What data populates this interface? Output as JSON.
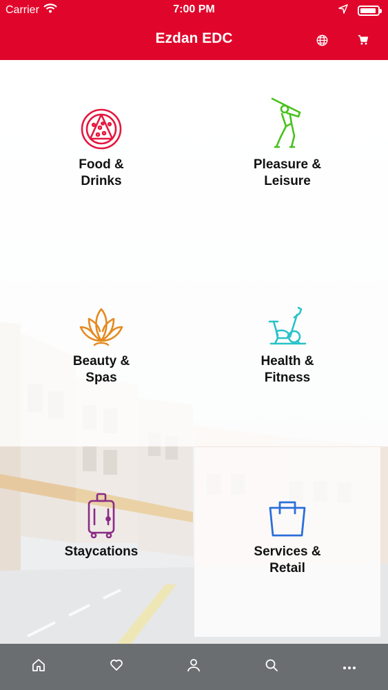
{
  "status_bar": {
    "carrier": "Carrier",
    "time": "7:00 PM"
  },
  "header": {
    "title": "Ezdan EDC",
    "globe_icon": "globe-icon",
    "cart_icon": "cart-icon"
  },
  "categories": [
    {
      "label": "Food &\nDrinks",
      "icon": "pizza-icon",
      "color": "#E5173F"
    },
    {
      "label": "Pleasure &\nLeisure",
      "icon": "golfer-icon",
      "color": "#46C21B"
    },
    {
      "label": "Beauty &\nSpas",
      "icon": "lotus-icon",
      "color": "#E58A1F"
    },
    {
      "label": "Health &\nFitness",
      "icon": "exercise-bike-icon",
      "color": "#27C2C9"
    },
    {
      "label": "Staycations",
      "icon": "luggage-icon",
      "color": "#8B2B86"
    },
    {
      "label": "Services &\nRetail",
      "icon": "shopping-bag-icon",
      "color": "#2A6FDB"
    }
  ],
  "tabbar": [
    "home-icon",
    "heart-icon",
    "profile-icon",
    "search-icon",
    "more-icon"
  ],
  "colors": {
    "brand": "#E0062B",
    "tabbar": "#6B6E70"
  }
}
